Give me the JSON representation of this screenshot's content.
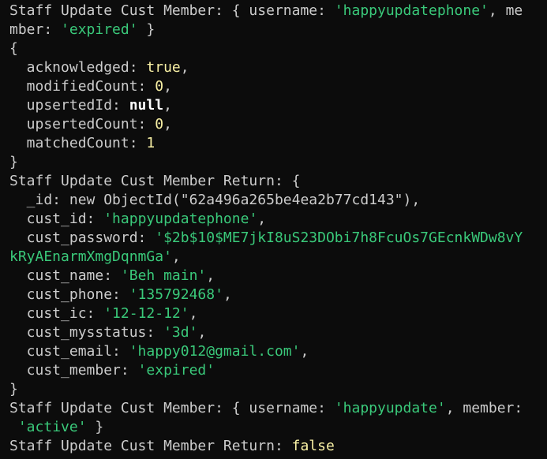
{
  "colors": {
    "background": "#0c0c0c",
    "text": "#cccccc",
    "string": "#3ac97a",
    "number": "#f9f1a5",
    "boolean": "#f9f1a5",
    "null": "#ffffff"
  },
  "lines": [
    [
      {
        "t": "plain",
        "v": "Staff Update Cust Member: { username: "
      },
      {
        "t": "str",
        "v": "'happyupdatephone'"
      },
      {
        "t": "plain",
        "v": ", me"
      }
    ],
    [
      {
        "t": "plain",
        "v": "mber: "
      },
      {
        "t": "str",
        "v": "'expired'"
      },
      {
        "t": "plain",
        "v": " }"
      }
    ],
    [
      {
        "t": "plain",
        "v": "{"
      }
    ],
    [
      {
        "t": "plain",
        "v": "  acknowledged: "
      },
      {
        "t": "bool",
        "v": "true"
      },
      {
        "t": "plain",
        "v": ","
      }
    ],
    [
      {
        "t": "plain",
        "v": "  modifiedCount: "
      },
      {
        "t": "num",
        "v": "0"
      },
      {
        "t": "plain",
        "v": ","
      }
    ],
    [
      {
        "t": "plain",
        "v": "  upsertedId: "
      },
      {
        "t": "null",
        "v": "null"
      },
      {
        "t": "plain",
        "v": ","
      }
    ],
    [
      {
        "t": "plain",
        "v": "  upsertedCount: "
      },
      {
        "t": "num",
        "v": "0"
      },
      {
        "t": "plain",
        "v": ","
      }
    ],
    [
      {
        "t": "plain",
        "v": "  matchedCount: "
      },
      {
        "t": "num",
        "v": "1"
      }
    ],
    [
      {
        "t": "plain",
        "v": "}"
      }
    ],
    [
      {
        "t": "plain",
        "v": "Staff Update Cust Member Return: {"
      }
    ],
    [
      {
        "t": "plain",
        "v": "  _id: new ObjectId(\"62a496a265be4ea2b77cd143\"),"
      }
    ],
    [
      {
        "t": "plain",
        "v": "  cust_id: "
      },
      {
        "t": "str",
        "v": "'happyupdatephone'"
      },
      {
        "t": "plain",
        "v": ","
      }
    ],
    [
      {
        "t": "plain",
        "v": "  cust_password: "
      },
      {
        "t": "str",
        "v": "'$2b$10$ME7jkI8uS23DObi7h8FcuOs7GEcnkWDw8vY"
      }
    ],
    [
      {
        "t": "str",
        "v": "kRyAEnarmXmgDqnmGa'"
      },
      {
        "t": "plain",
        "v": ","
      }
    ],
    [
      {
        "t": "plain",
        "v": "  cust_name: "
      },
      {
        "t": "str",
        "v": "'Beh main'"
      },
      {
        "t": "plain",
        "v": ","
      }
    ],
    [
      {
        "t": "plain",
        "v": "  cust_phone: "
      },
      {
        "t": "str",
        "v": "'135792468'"
      },
      {
        "t": "plain",
        "v": ","
      }
    ],
    [
      {
        "t": "plain",
        "v": "  cust_ic: "
      },
      {
        "t": "str",
        "v": "'12-12-12'"
      },
      {
        "t": "plain",
        "v": ","
      }
    ],
    [
      {
        "t": "plain",
        "v": "  cust_mysstatus: "
      },
      {
        "t": "str",
        "v": "'3d'"
      },
      {
        "t": "plain",
        "v": ","
      }
    ],
    [
      {
        "t": "plain",
        "v": "  cust_email: "
      },
      {
        "t": "str",
        "v": "'happy012@gmail.com'"
      },
      {
        "t": "plain",
        "v": ","
      }
    ],
    [
      {
        "t": "plain",
        "v": "  cust_member: "
      },
      {
        "t": "str",
        "v": "'expired'"
      }
    ],
    [
      {
        "t": "plain",
        "v": "}"
      }
    ],
    [
      {
        "t": "plain",
        "v": "Staff Update Cust Member: { username: "
      },
      {
        "t": "str",
        "v": "'happyupdate'"
      },
      {
        "t": "plain",
        "v": ", member:"
      }
    ],
    [
      {
        "t": "plain",
        "v": " "
      },
      {
        "t": "str",
        "v": "'active'"
      },
      {
        "t": "plain",
        "v": " }"
      }
    ],
    [
      {
        "t": "plain",
        "v": "Staff Update Cust Member Return: "
      },
      {
        "t": "bool",
        "v": "false"
      }
    ]
  ]
}
